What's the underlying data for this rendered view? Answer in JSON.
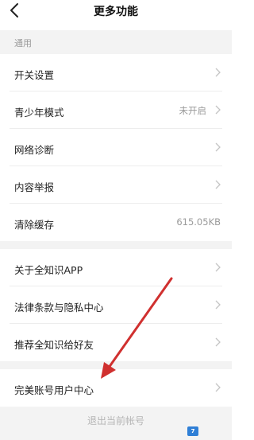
{
  "header": {
    "title": "更多功能"
  },
  "section": {
    "label": "通用"
  },
  "rows": [
    {
      "label": "开关设置",
      "value": ""
    },
    {
      "label": "青少年模式",
      "value": "未开启"
    },
    {
      "label": "网络诊断",
      "value": ""
    },
    {
      "label": "内容举报",
      "value": ""
    },
    {
      "label": "清除缓存",
      "value": "615.05KB"
    },
    {
      "label": "关于全知识APP",
      "value": ""
    },
    {
      "label": "法律条款与隐私中心",
      "value": ""
    },
    {
      "label": "推荐全知识给好友",
      "value": ""
    },
    {
      "label": "完美账号用户中心",
      "value": ""
    }
  ],
  "footer": {
    "logout": "退出当前帐号"
  },
  "annotation": {
    "arrow_color": "#d0302f"
  },
  "colors": {
    "section_bg": "#f3f3f3",
    "secondary_text": "#9a9a9a"
  }
}
